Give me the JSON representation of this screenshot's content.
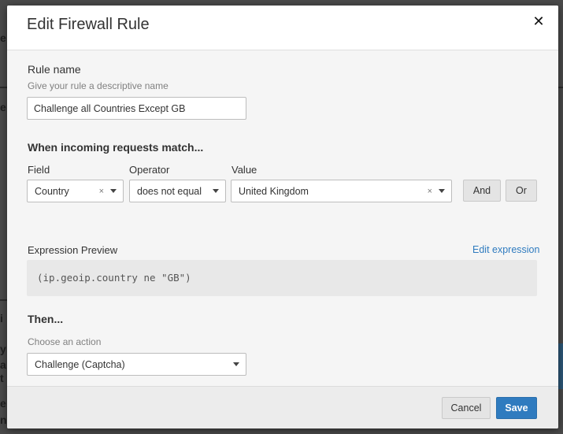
{
  "modal": {
    "title": "Edit Firewall Rule"
  },
  "rule_name": {
    "label": "Rule name",
    "hint": "Give your rule a descriptive name",
    "value": "Challenge all Countries Except GB"
  },
  "match": {
    "section_title": "When incoming requests match...",
    "field_label": "Field",
    "operator_label": "Operator",
    "value_label": "Value",
    "field_value": "Country",
    "operator_value": "does not equal",
    "value_value": "United Kingdom",
    "clear_glyph": "×",
    "and_label": "And",
    "or_label": "Or"
  },
  "expression": {
    "label": "Expression Preview",
    "edit_link": "Edit expression",
    "code": "(ip.geoip.country ne \"GB\")"
  },
  "action": {
    "section_title": "Then...",
    "hint": "Choose an action",
    "value": "Challenge (Captcha)"
  },
  "footer": {
    "cancel_label": "Cancel",
    "save_label": "Save"
  },
  "icons": {
    "close": "✕"
  },
  "colors": {
    "primary": "#2f7bbf",
    "link": "#2f7bbf"
  }
}
